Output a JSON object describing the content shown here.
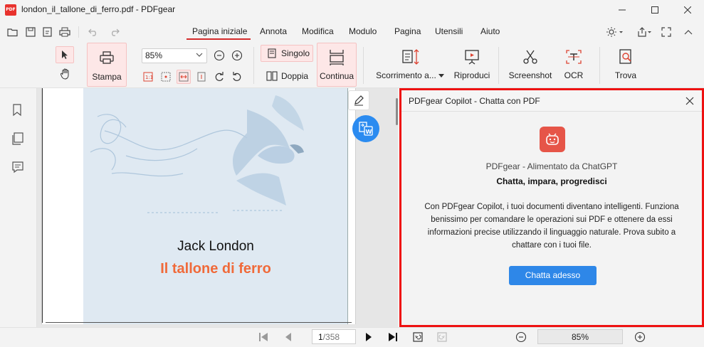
{
  "window": {
    "app_logo_text": "PDF",
    "title": "london_il_tallone_di_ferro.pdf - PDFgear"
  },
  "tabs": [
    {
      "label": "Pagina iniziale",
      "active": true
    },
    {
      "label": "Annota"
    },
    {
      "label": "Modifica"
    },
    {
      "label": "Modulo"
    },
    {
      "label": "Pagina"
    },
    {
      "label": "Utensili"
    },
    {
      "label": "Aiuto"
    }
  ],
  "ribbon": {
    "print_label": "Stampa",
    "zoom_value": "85%",
    "single_label": "Singolo",
    "double_label": "Doppia",
    "continuous_label": "Continua",
    "scroll_label": "Scorrimento a...",
    "play_label": "Riproduci",
    "screenshot_label": "Screenshot",
    "ocr_label": "OCR",
    "find_label": "Trova"
  },
  "document": {
    "author": "Jack London",
    "title": "Il tallone di ferro"
  },
  "copilot": {
    "header": "PDFgear Copilot - Chatta con PDF",
    "subtitle": "PDFgear - Alimentato da ChatGPT",
    "tagline": "Chatta, impara, progredisci",
    "description": "Con PDFgear Copilot, i tuoi documenti diventano intelligenti.  Funziona benissimo per comandare le operazioni sui PDF e ottenere da essi informazioni precise utilizzando il linguaggio naturale.  Prova subito a chattare con i tuoi file.",
    "button": "Chatta adesso"
  },
  "statusbar": {
    "current_page": "1",
    "total_pages": "/358",
    "zoom": "85%"
  },
  "colors": {
    "accent_red": "#d42b2b",
    "highlight_border": "#ee1111",
    "primary_blue": "#2e87e8",
    "title_orange": "#f06a3a",
    "page_bg": "#dfe9f2"
  }
}
